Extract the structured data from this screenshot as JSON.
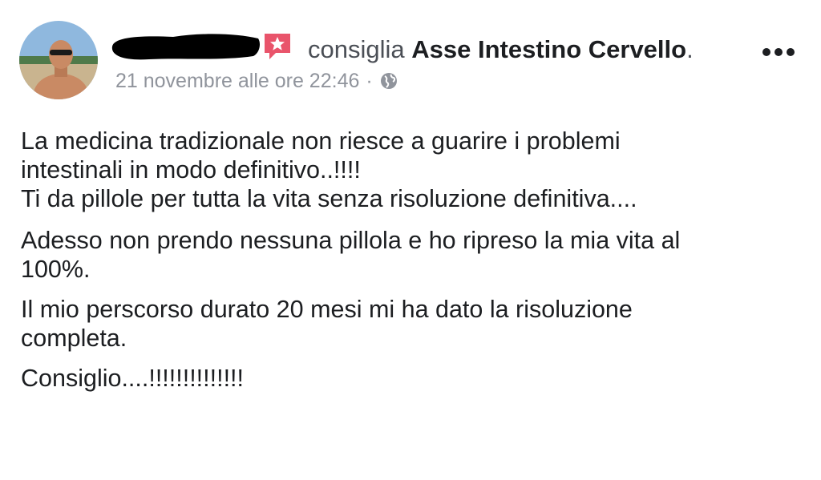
{
  "post": {
    "verb": "consiglia",
    "page_name": "Asse Intestino Cervello",
    "page_suffix": ".",
    "timestamp": "21 novembre alle ore 22:46",
    "separator": "·",
    "privacy_icon": "globe-icon",
    "recommend_icon": "recommend-star-icon",
    "menu_icon": "more-options-icon",
    "accent_color": "#e9546b",
    "paragraphs": [
      "La medicina tradizionale non riesce a guarire i problemi\nintestinali in modo definitivo..!!!!\nTi da pillole per tutta la vita senza risoluzione definitiva....",
      "Adesso non prendo nessuna pillola e ho ripreso la mia vita al\n100%.",
      "Il mio perscorso durato 20 mesi mi ha dato la risoluzione\ncompleta.",
      "Consiglio....!!!!!!!!!!!!!!"
    ]
  }
}
